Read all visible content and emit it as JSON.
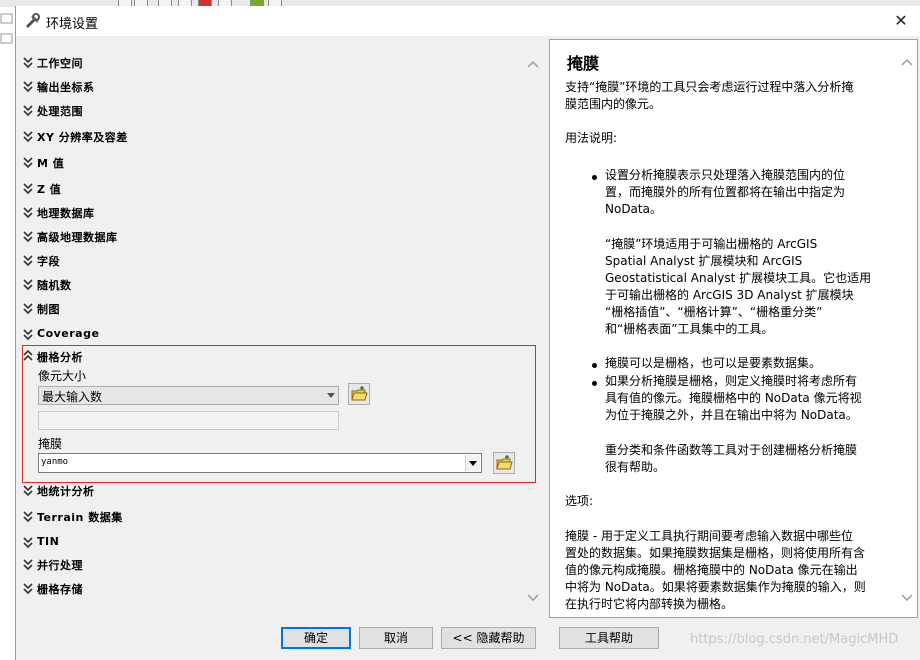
{
  "window": {
    "title": "环境设置"
  },
  "sections_top": [
    {
      "label": "工作空间"
    },
    {
      "label": "输出坐标系"
    },
    {
      "label": "处理范围"
    },
    {
      "label": "XY 分辨率及容差"
    },
    {
      "label": "M 值"
    },
    {
      "label": "Z 值"
    },
    {
      "label": "地理数据库"
    },
    {
      "label": "高级地理数据库"
    },
    {
      "label": "字段"
    },
    {
      "label": "随机数"
    },
    {
      "label": "制图"
    },
    {
      "label": "Coverage"
    }
  ],
  "raster": {
    "label": "栅格分析",
    "cell_size_label": "像元大小",
    "cell_size_value": "最大输入数",
    "cell_size_text": "",
    "mask_label": "掩膜",
    "mask_value": "yanmo"
  },
  "sections_bottom": [
    {
      "label": "地统计分析"
    },
    {
      "label": "Terrain 数据集"
    },
    {
      "label": "TIN"
    },
    {
      "label": "并行处理"
    },
    {
      "label": "栅格存储"
    }
  ],
  "help": {
    "title": "掩膜",
    "intro": [
      "支持“掩膜”环境的工具只会考虑运行过程中落入分析掩",
      "膜范围内的像元。"
    ],
    "usage_heading": "用法说明:",
    "bullet1": [
      "设置分析掩膜表示只处理落入掩膜范围内的位",
      "置，而掩膜外的所有位置都将在输出中指定为",
      "NoData。"
    ],
    "para1": [
      "“掩膜”环境适用于可输出栅格的 ArcGIS",
      "Spatial Analyst 扩展模块和 ArcGIS",
      "Geostatistical Analyst 扩展模块工具。它也适用",
      "于可输出栅格的 ArcGIS 3D Analyst 扩展模块",
      "“栅格插值”、“栅格计算”、“栅格重分类”",
      "和“栅格表面”工具集中的工具。"
    ],
    "bullet2": [
      "掩膜可以是栅格，也可以是要素数据集。"
    ],
    "bullet3": [
      "如果分析掩膜是栅格，则定义掩膜时将考虑所有",
      "具有值的像元。掩膜栅格中的 NoData 像元将视",
      "为位于掩膜之外，并且在输出中将为 NoData。"
    ],
    "para2": [
      "重分类和条件函数等工具对于创建栅格分析掩膜",
      "很有帮助。"
    ],
    "options_heading": "选项:",
    "options": [
      "掩膜 - 用于定义工具执行期间要考虑输入数据中哪些位",
      "置处的数据集。如果掩膜数据集是栅格，则将使用所有含",
      "值的像元构成掩膜。栅格掩膜中的 NoData 像元在输出",
      "中将为 NoData。如果将要素数据集作为掩膜的输入，则",
      "在执行时它将内部转换为栅格。"
    ]
  },
  "buttons": {
    "ok": "确定",
    "cancel": "取消",
    "hide_help": "<< 隐藏帮助",
    "tool_help": "工具帮助"
  },
  "watermark": "https://blog.csdn.net/MagicMHD"
}
